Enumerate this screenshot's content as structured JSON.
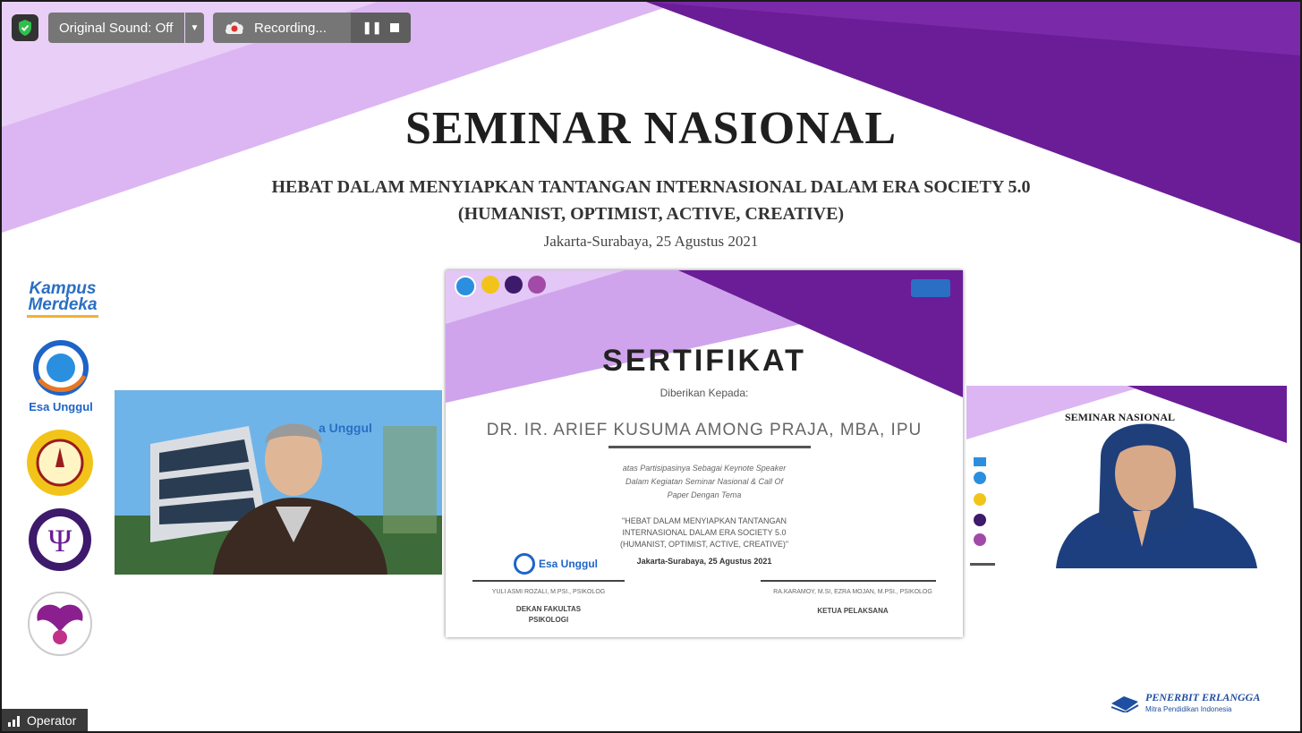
{
  "toolbar": {
    "original_sound_label": "Original Sound: Off",
    "recording_label": "Recording..."
  },
  "slide": {
    "title": "SEMINAR NASIONAL",
    "subtitle_line1": "HEBAT DALAM MENYIAPKAN TANTANGAN INTERNASIONAL DALAM ERA SOCIETY 5.0",
    "subtitle_line2": "(HUMANIST, OPTIMIST, ACTIVE, CREATIVE)",
    "date": "Jakarta-Surabaya, 25 Agustus 2021",
    "logos": {
      "kampus_merdeka_line1": "Kampus",
      "kampus_merdeka_line2": "Merdeka",
      "esa_unggul": "Esa Unggul"
    },
    "publisher": {
      "name": "PENERBIT ERLANGGA",
      "tagline": "Mitra Pendidikan Indonesia"
    }
  },
  "certificate": {
    "title": "SERTIFIKAT",
    "given_to": "Diberikan Kepada:",
    "recipient": "DR. IR. ARIEF KUSUMA AMONG PRAJA, MBA, IPU",
    "body_lines": [
      "atas Partisipasinya Sebagai Keynote Speaker",
      "Dalam Kegiatan Seminar Nasional & Call Of",
      "Paper Dengan Tema"
    ],
    "theme_lines": [
      "\"HEBAT DALAM MENYIAPKAN TANTANGAN",
      "INTERNASIONAL DALAM ERA SOCIETY 5.0",
      "(HUMANIST, OPTIMIST, ACTIVE, CREATIVE)\""
    ],
    "date": "Jakarta-Surabaya, 25 Agustus 2021",
    "left_signatory_name": "YULI ASMI ROZALI, M.PSI., PSIKOLOG",
    "left_signatory_role_line1": "DEKAN FAKULTAS",
    "left_signatory_role_line2": "PSIKOLOGI",
    "right_signatory_name": "RA.KARAMOY, M.SI, EZRA MOJAN, M.PSI., PSIKOLOG",
    "right_signatory_role": "KETUA PELAKSANA",
    "logo_text": "Esa Unggul"
  },
  "speaker_tile": {
    "background_text": "a Unggul"
  },
  "moderator_tile": {
    "slide_title": "SEMINAR NASIONAL"
  },
  "operator": {
    "label": "Operator"
  },
  "colors": {
    "purple_dark": "#6a1d96",
    "purple_light": "#d9b3f0",
    "control_gray": "#767676"
  }
}
